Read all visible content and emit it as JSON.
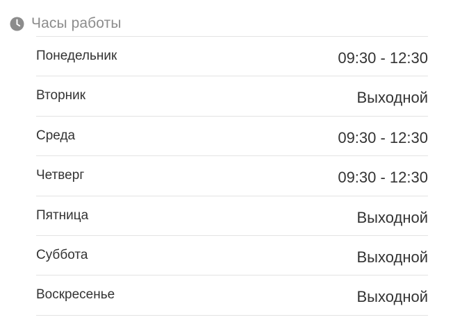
{
  "header": {
    "title": "Часы работы",
    "icon": "clock-icon",
    "icon_color": "#8c8c8c"
  },
  "schedule": {
    "rows": [
      {
        "day": "Понедельник",
        "hours": "09:30 - 12:30"
      },
      {
        "day": "Вторник",
        "hours": "Выходной"
      },
      {
        "day": "Среда",
        "hours": "09:30 - 12:30"
      },
      {
        "day": "Четверг",
        "hours": "09:30 - 12:30"
      },
      {
        "day": "Пятница",
        "hours": "Выходной"
      },
      {
        "day": "Суббота",
        "hours": "Выходной"
      },
      {
        "day": "Воскресенье",
        "hours": "Выходной"
      }
    ]
  },
  "colors": {
    "text": "#333333",
    "muted": "#8c8c8c",
    "divider": "#e3e3e3"
  }
}
